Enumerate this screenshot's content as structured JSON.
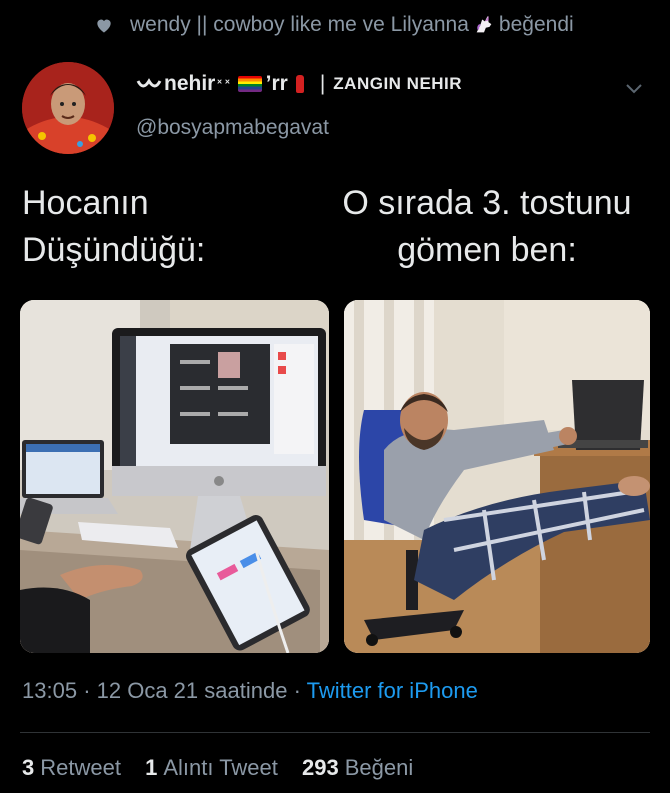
{
  "liked_by": {
    "text": "wendy || cowboy like me ve Lilyanna",
    "suffix": "beğendi",
    "icon": "heart-icon"
  },
  "author": {
    "display_name_prefix": "nehir",
    "display_name_mid": "’rr",
    "brand": "ZANGIN NEHIR",
    "separator": "|",
    "handle": "@bosyapmabegavat"
  },
  "captions": {
    "left": [
      "Hocanın",
      "Düşündüğü:"
    ],
    "right": [
      "O sırada 3. tostunu",
      "gömen ben:"
    ]
  },
  "meta": {
    "time": "13:05",
    "dot1": "·",
    "date": "12 Oca 21 saatinde",
    "dot2": "·",
    "source": "Twitter for iPhone"
  },
  "stats": {
    "retweets_count": "3",
    "retweets_label": "Retweet",
    "quotes_count": "1",
    "quotes_label": "Alıntı Tweet",
    "likes_count": "293",
    "likes_label": "Beğeni"
  },
  "colors": {
    "background": "#000000",
    "text": "#e7e9ea",
    "muted": "#8b98a5",
    "link": "#1d9bf0"
  }
}
